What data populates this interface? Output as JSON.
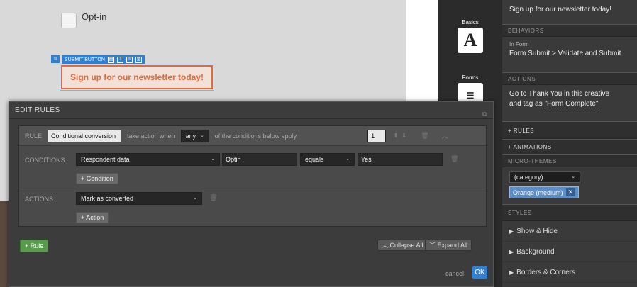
{
  "canvas": {
    "optin_label": "Opt-in",
    "toolbar_label": "SUBMIT BUTTON",
    "submit_text": "Sign up for our newsletter today!"
  },
  "iconbar": {
    "items": [
      {
        "label": "Basics",
        "icon": "typography-icon",
        "glyph": "A"
      },
      {
        "label": "Forms",
        "icon": "form-icon"
      }
    ]
  },
  "panel": {
    "top_text": "Sign up for our newsletter today!",
    "behaviors_header": "BEHAVIORS",
    "behavior_context": "In Form",
    "behavior_value": "Form Submit > Validate and Submit",
    "actions_header": "ACTIONS",
    "actions_line1": "Go to Thank You in this creative",
    "actions_line2_pre": "and tag as ",
    "actions_tag": "\"Form Complete\"",
    "rules_header": "+ RULES",
    "animations_header": "+ ANIMATIONS",
    "microthemes_header": "MICRO-THEMES",
    "category_select": "(category)",
    "theme_tag": "Orange (medium)",
    "styles_header": "STYLES",
    "styles": [
      "Show & Hide",
      "Background",
      "Borders & Corners"
    ]
  },
  "modal": {
    "title": "EDIT RULES",
    "rule_label": "RULE",
    "rule_name": "Conditional conversion",
    "take_action": "take action when",
    "match_select": "any",
    "conditions_apply": "of the conditions below apply",
    "priority": "1",
    "conditions_label": "CONDITIONS:",
    "condition_source": "Respondent data",
    "condition_field": "Optin",
    "condition_operator": "equals",
    "condition_value": "Yes",
    "add_condition": "+ Condition",
    "actions_label": "ACTIONS:",
    "action_select": "Mark as converted",
    "add_action": "+ Action",
    "add_rule": "+ Rule",
    "collapse_all": "Collapse All",
    "expand_all": "Expand All",
    "cancel": "cancel",
    "ok": "OK"
  },
  "colors": {
    "accent": "#2f82d5",
    "submit_orange": "#e06a3a",
    "add_green": "#5a9a4e"
  }
}
